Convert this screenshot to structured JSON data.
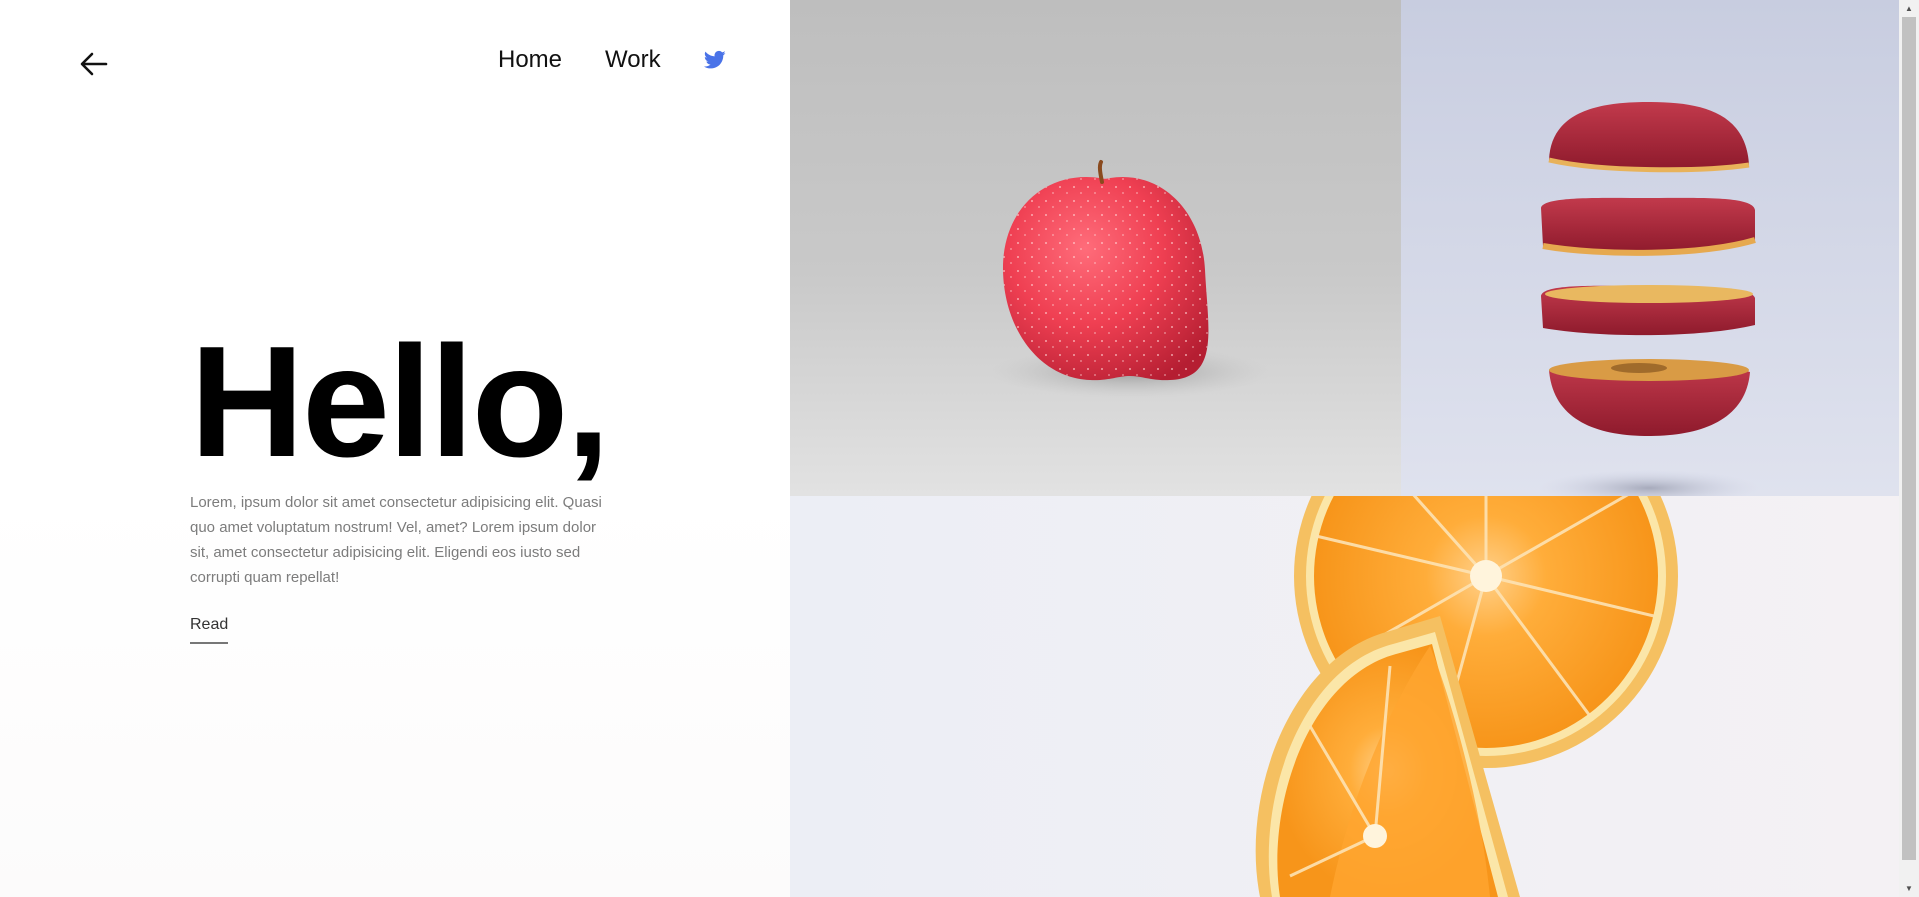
{
  "nav": {
    "back_icon": "arrow-left-icon",
    "links": [
      "Home",
      "Work"
    ],
    "social_icon": "twitter-icon"
  },
  "hero": {
    "title": "Hello,",
    "body": "Lorem, ipsum dolor sit amet consectetur adipisicing elit. Quasi quo amet voluptatum nostrum! Vel, amet? Lorem ipsum dolor sit, amet consectetur adipisicing elit. Eligendi eos iusto sed corrupti quam repellat!",
    "read_label": "Read"
  },
  "gallery": {
    "images": [
      "red-apple-photo",
      "sliced-apple-photo",
      "orange-halves-photo"
    ]
  },
  "colors": {
    "text": "#000000",
    "body_text": "#7c7c7c",
    "twitter": "#4a73e8"
  },
  "scrollbar": {
    "up_icon": "scroll-up-arrow-icon",
    "down_icon": "scroll-down-arrow-icon"
  }
}
